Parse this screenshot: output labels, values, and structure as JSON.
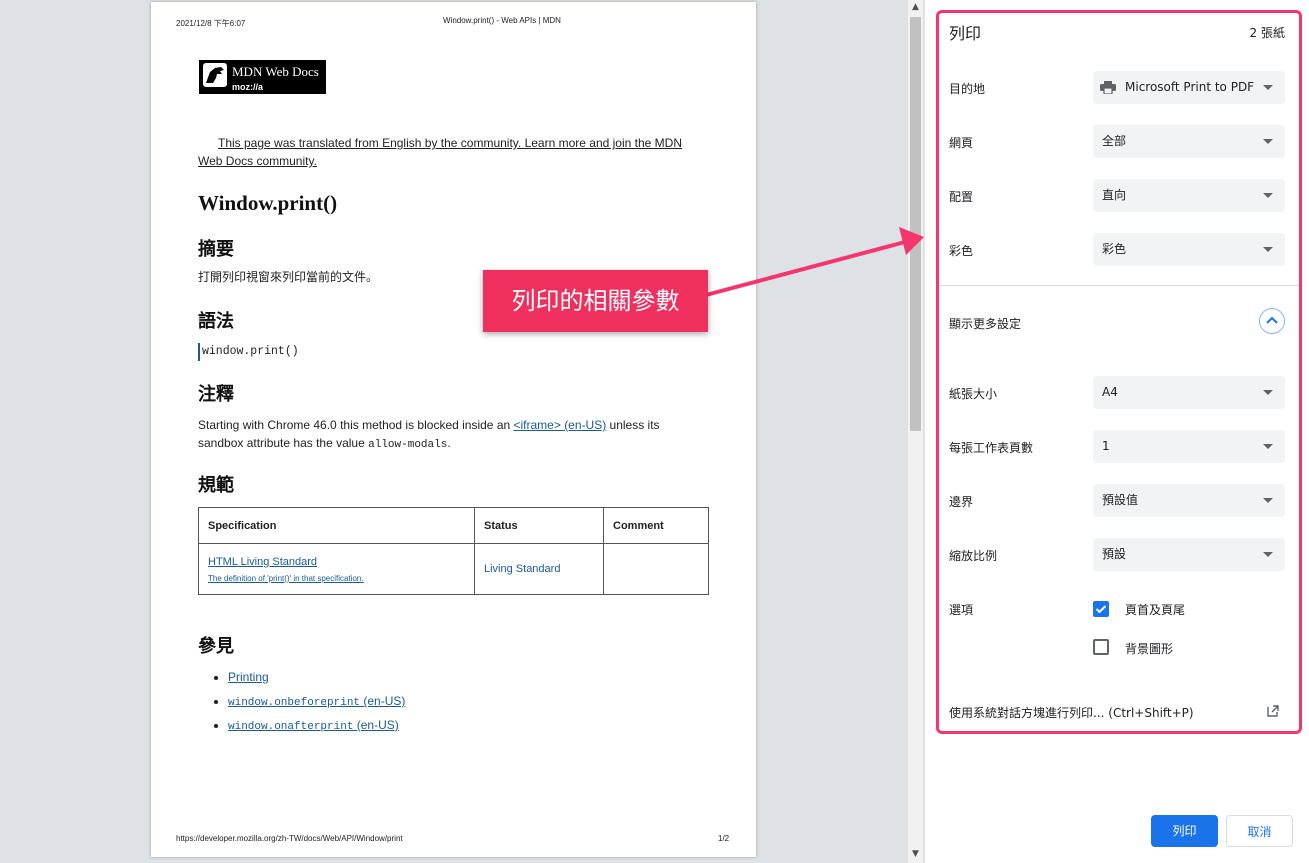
{
  "preview": {
    "header_date": "2021/12/8 下午6:07",
    "header_title": "Window.print() - Web APIs | MDN",
    "logo_text": "MDN Web Docs",
    "logo_sub": "moz://a",
    "notice": "This page was translated from English by the community. Learn more and join the MDN Web Docs community.",
    "h1": "Window.print()",
    "h_summary": "摘要",
    "summary_text": "打開列印視窗來列印當前的文件。",
    "h_syntax": "語法",
    "syntax_code": "window.print()",
    "h_notes": "注釋",
    "notes_prefix": "Starting with Chrome 46.0 this method is blocked inside an ",
    "notes_link": "<iframe> (en-US)",
    "notes_suffix": " unless its sandbox attribute has the value ",
    "notes_code": "allow-modals",
    "notes_end": ".",
    "h_spec": "規範",
    "table": {
      "headers": [
        "Specification",
        "Status",
        "Comment"
      ],
      "row": {
        "spec_link": "HTML Living Standard",
        "spec_desc": "The definition of 'print()' in that specification.",
        "status": "Living Standard",
        "comment": ""
      }
    },
    "h_see": "參見",
    "see_also": [
      {
        "code": "",
        "text": "Printing"
      },
      {
        "code": "window.onbeforeprint",
        "text": " (en-US)"
      },
      {
        "code": "window.onafterprint",
        "text": " (en-US)"
      }
    ],
    "footer_url": "https://developer.mozilla.org/zh-TW/docs/Web/API/Window/print",
    "footer_page": "1/2"
  },
  "dialog": {
    "title": "列印",
    "sheets": "2 張紙",
    "destination_label": "目的地",
    "destination_value": "Microsoft Print to PDF",
    "pages_label": "網頁",
    "pages_value": "全部",
    "layout_label": "配置",
    "layout_value": "直向",
    "color_label": "彩色",
    "color_value": "彩色",
    "more_settings_label": "顯示更多設定",
    "paper_size_label": "紙張大小",
    "paper_size_value": "A4",
    "pages_per_sheet_label": "每張工作表頁數",
    "pages_per_sheet_value": "1",
    "margins_label": "邊界",
    "margins_value": "預設值",
    "scale_label": "縮放比例",
    "scale_value": "預設",
    "options_label": "選項",
    "option_headers": "頁首及頁尾",
    "option_headers_checked": true,
    "option_background": "背景圖形",
    "option_background_checked": false,
    "system_dialog_label": "使用系統對話方塊進行列印... (Ctrl+Shift+P)",
    "print_button": "列印",
    "cancel_button": "取消"
  },
  "annotation": {
    "callout_text": "列印的相關參數",
    "highlight_color": "#f5356e",
    "callout_color": "#ef2f5e"
  },
  "colors": {
    "accent": "#1a73e8",
    "link": "#1a5a96"
  }
}
